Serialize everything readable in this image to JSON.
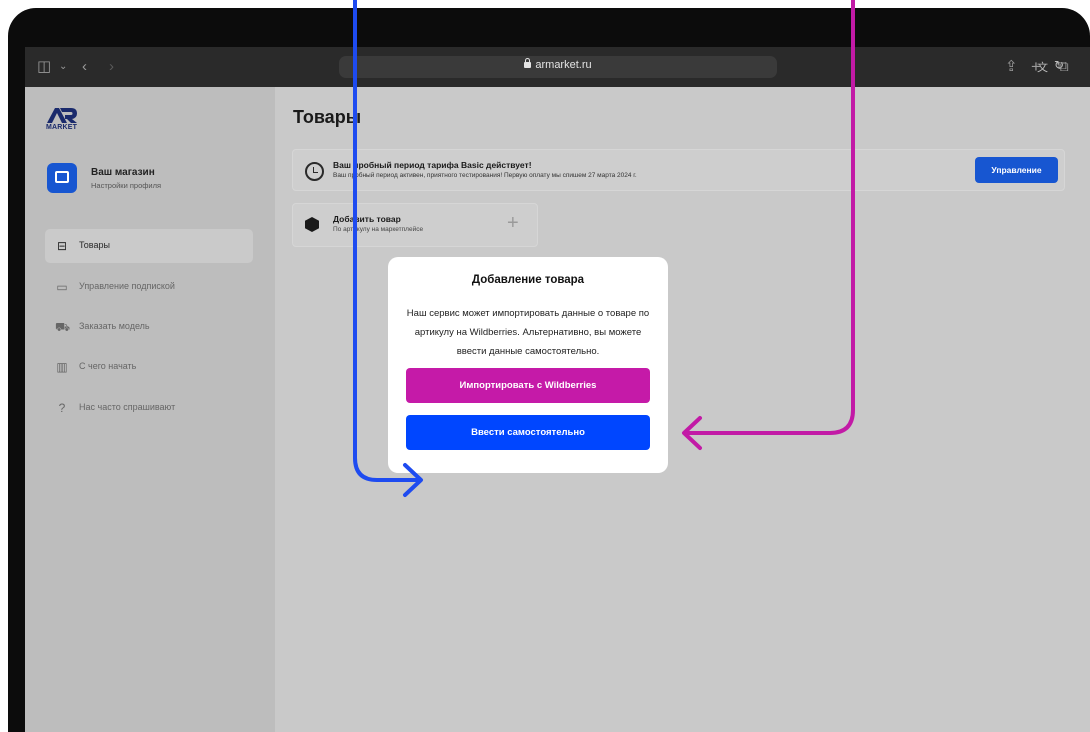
{
  "browser": {
    "url": "armarket.ru"
  },
  "sidebar": {
    "logo_text": "MARKET",
    "store": {
      "title": "Ваш магазин",
      "subtitle": "Настройки профиля"
    },
    "items": [
      {
        "label": "Товары",
        "icon": "box-outline-icon",
        "active": true
      },
      {
        "label": "Управление подпиской",
        "icon": "card-icon",
        "active": false
      },
      {
        "label": "Заказать модель",
        "icon": "cart-icon",
        "active": false
      },
      {
        "label": "С чего начать",
        "icon": "map-icon",
        "active": false
      },
      {
        "label": "Нас часто спрашивают",
        "icon": "question-icon",
        "active": false
      }
    ]
  },
  "main": {
    "title": "Товары",
    "trial": {
      "title": "Ваш пробный период тарифа Basic действует!",
      "text": "Ваш пробный период активен, приятного тестирования! Первую оплату мы спишем 27 марта 2024 г.",
      "button": "Управление"
    },
    "add_card": {
      "title": "Добавить товар",
      "subtitle": "По артикулу на маркетплейсе"
    }
  },
  "modal": {
    "title": "Добавление товара",
    "text": "Наш сервис может импортировать данные о товаре по артикулу на Wildberries. Альтернативно, вы можете ввести данные самостоятельно.",
    "import_button": "Импортировать с Wildberries",
    "manual_button": "Ввести самостоятельно"
  },
  "colors": {
    "accent_blue": "#1756d1",
    "manual_blue": "#0046ff",
    "import_magenta": "#c51aa8",
    "arrow_blue": "#1e4bf0",
    "arrow_magenta": "#c21aa6"
  }
}
